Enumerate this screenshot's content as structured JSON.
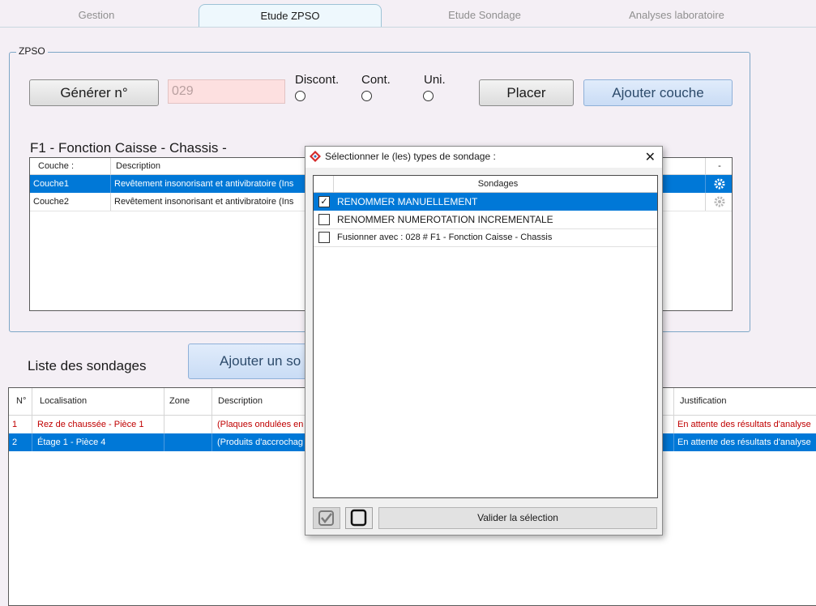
{
  "tabs": [
    {
      "label": "Gestion",
      "active": false
    },
    {
      "label": "Etude ZPSO",
      "active": true
    },
    {
      "label": "Etude Sondage",
      "active": false
    },
    {
      "label": "Analyses laboratoire",
      "active": false
    }
  ],
  "zpso": {
    "legend": "ZPSO",
    "generate_label": "Générer n°",
    "number_value": "029",
    "radios": [
      "Discont.",
      "Cont.",
      "Uni."
    ],
    "placer_label": "Placer",
    "add_layer_label": "Ajouter couche",
    "section_title": "F1 - Fonction Caisse - Chassis -",
    "couches": {
      "headers": [
        "Couche :",
        "Description",
        "-"
      ],
      "rows": [
        {
          "couche": "Couche1",
          "description": "Revêtement insonorisant et antivibratoire (Ins"
        },
        {
          "couche": "Couche2",
          "description": "Revêtement insonorisant et antivibratoire (Ins"
        }
      ]
    }
  },
  "sondages": {
    "title": "Liste des sondages",
    "add_label": "Ajouter un so",
    "headers": [
      "N°",
      "Localisation",
      "Zone",
      "Description",
      "Justification"
    ],
    "rows": [
      {
        "num": "1",
        "localisation": "Rez de chaussée - Pièce 1",
        "zone": "",
        "description": "(Plaques ondulées en",
        "justification": "En attente des résultats d'analyse"
      },
      {
        "num": "2",
        "localisation": "Étage  1 - Pièce  4",
        "zone": "",
        "description": "(Produits d'accrochag",
        "justification": "En attente des résultats d'analyse"
      }
    ]
  },
  "dialog": {
    "title": "Sélectionner le (les) types de sondage :",
    "close": "✕",
    "header": "Sondages",
    "items": [
      {
        "label": "RENOMMER MANUELLEMENT",
        "checked": true
      },
      {
        "label": "RENOMMER NUMEROTATION INCREMENTALE",
        "checked": false
      },
      {
        "label": "Fusionner avec : 028 # F1 - Fonction Caisse - Chassis",
        "checked": false
      }
    ],
    "validate_label": "Valider la sélection",
    "check_mark": "✓"
  },
  "colors": {
    "selection": "#0078d7",
    "alert": "#c00000",
    "accent_tab": "#eef8fd"
  }
}
